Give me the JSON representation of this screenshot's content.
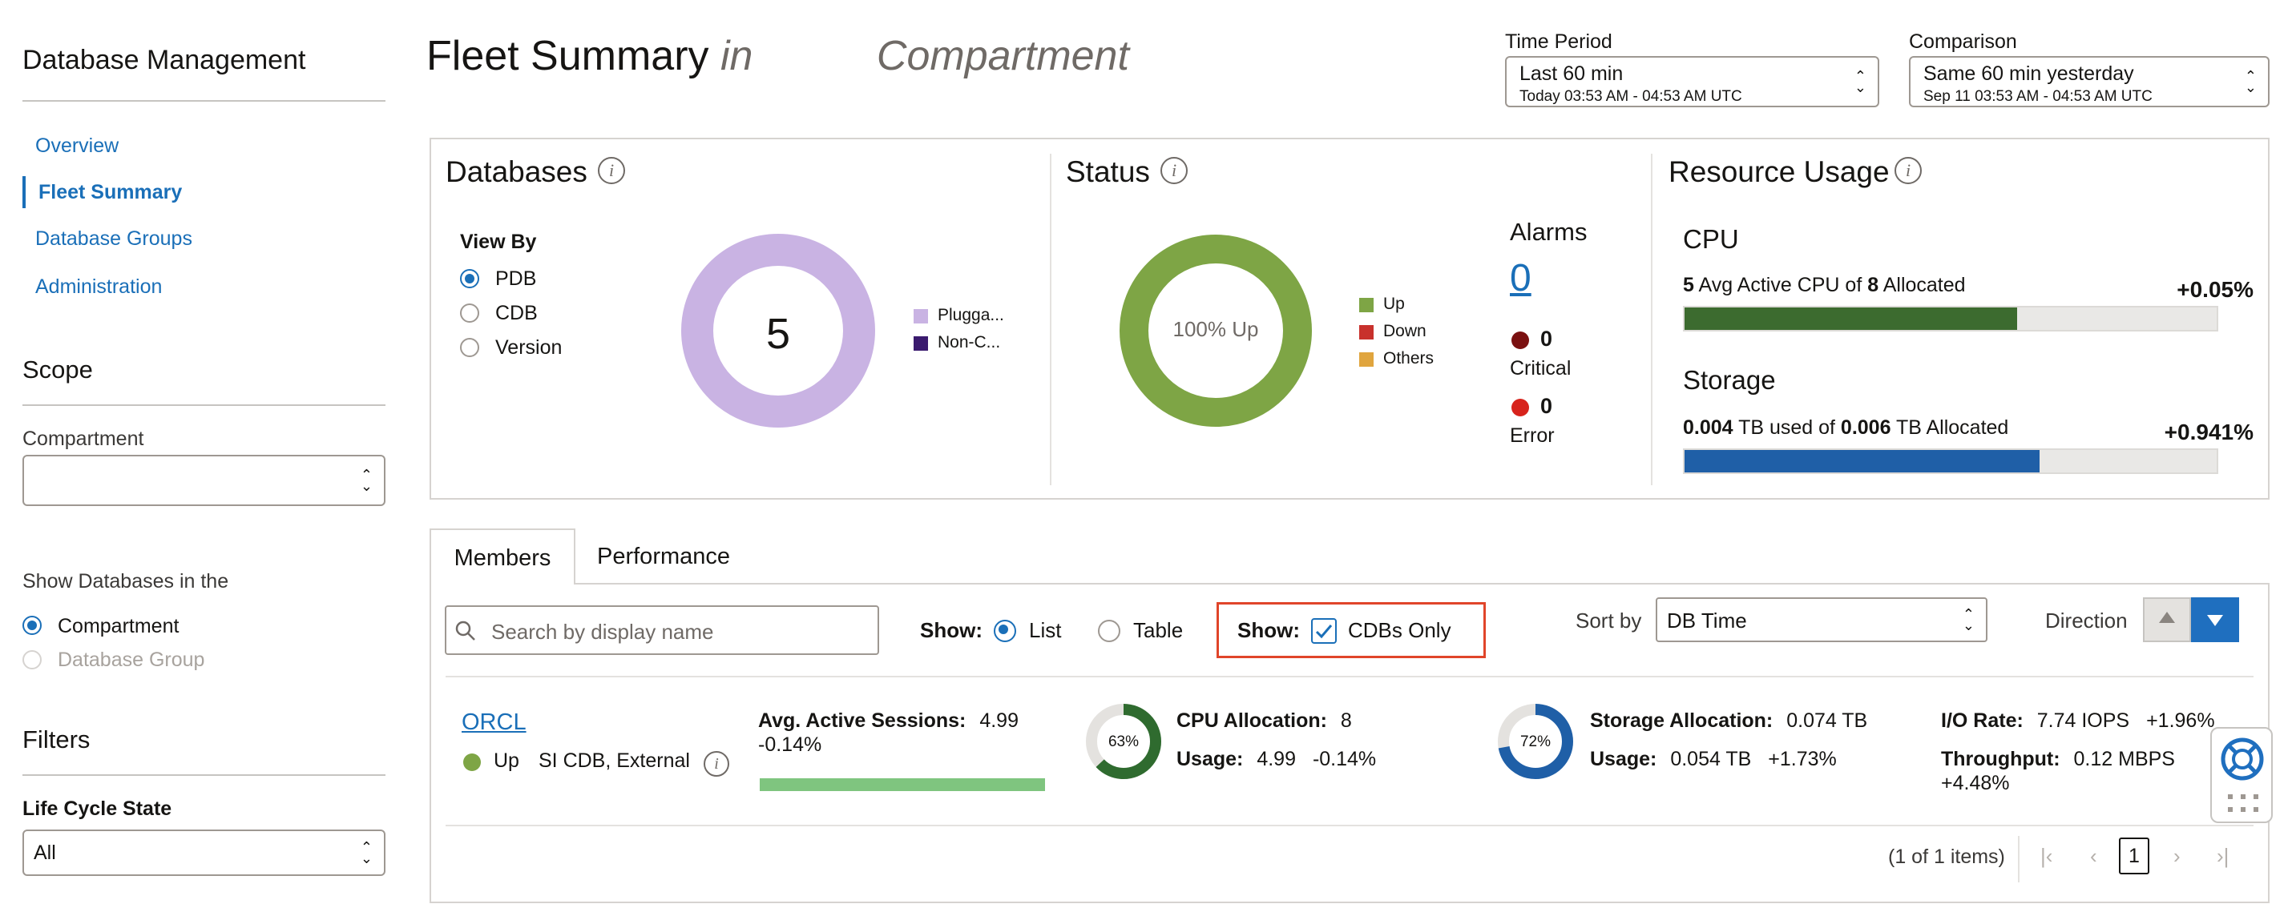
{
  "sidebar": {
    "title": "Database Management",
    "nav": [
      {
        "label": "Overview"
      },
      {
        "label": "Fleet Summary"
      },
      {
        "label": "Database Groups"
      },
      {
        "label": "Administration"
      }
    ],
    "scope_title": "Scope",
    "compartment_label": "Compartment",
    "compartment_value": "",
    "show_databases_label": "Show Databases in the",
    "show_options": [
      {
        "label": "Compartment",
        "selected": true
      },
      {
        "label": "Database Group",
        "selected": false
      }
    ],
    "filters_title": "Filters",
    "lifecycle_label": "Life Cycle State",
    "lifecycle_value": "All"
  },
  "header": {
    "title_main": "Fleet Summary",
    "title_in": "in",
    "title_compartment": "Compartment",
    "time_period_label": "Time Period",
    "time_period_value": "Last 60 min",
    "time_period_sub": "Today 03:53 AM - 04:53 AM UTC",
    "comparison_label": "Comparison",
    "comparison_value": "Same 60 min yesterday",
    "comparison_sub": "Sep 11 03:53 AM - 04:53 AM UTC"
  },
  "databases": {
    "title": "Databases",
    "view_by_label": "View By",
    "view_by_options": [
      {
        "label": "PDB",
        "selected": true
      },
      {
        "label": "CDB",
        "selected": false
      },
      {
        "label": "Version",
        "selected": false
      }
    ],
    "count": "5",
    "legend": [
      {
        "label": "Plugga...",
        "color": "#c9b3e3"
      },
      {
        "label": "Non-C...",
        "color": "#3a1a6e"
      }
    ]
  },
  "status": {
    "title": "Status",
    "donut_label": "100% Up",
    "donut_color": "#7ea545",
    "legend": [
      {
        "label": "Up",
        "color": "#7ea545"
      },
      {
        "label": "Down",
        "color": "#c8312c"
      },
      {
        "label": "Others",
        "color": "#e0a53e"
      }
    ],
    "alarms_title": "Alarms",
    "alarms_count": "0",
    "critical_count": "0",
    "critical_label": "Critical",
    "critical_color": "#7a1010",
    "error_count": "0",
    "error_label": "Error",
    "error_color": "#d7231c"
  },
  "resource": {
    "title": "Resource Usage",
    "cpu_title": "CPU",
    "cpu_avg": "5",
    "cpu_text1": "Avg Active CPU of",
    "cpu_alloc": "8",
    "cpu_text2": "Allocated",
    "cpu_change": "+0.05%",
    "cpu_fraction": 0.625,
    "cpu_color": "#3c6b2f",
    "storage_title": "Storage",
    "storage_used": "0.004",
    "storage_text1": "TB used of",
    "storage_alloc": "0.006",
    "storage_text2": "TB Allocated",
    "storage_change": "+0.941%",
    "storage_fraction": 0.667,
    "storage_color": "#1f5fa7"
  },
  "tabs": [
    {
      "label": "Members",
      "active": true
    },
    {
      "label": "Performance",
      "active": false
    }
  ],
  "toolbar": {
    "search_placeholder": "Search by display name",
    "show_label": "Show:",
    "list_label": "List",
    "table_label": "Table",
    "show2_label": "Show:",
    "cdbs_only_label": "CDBs Only",
    "sort_by_label": "Sort by",
    "sort_value": "DB Time",
    "direction_label": "Direction"
  },
  "member": {
    "name": "ORCL",
    "status": "Up",
    "type": "SI CDB, External",
    "aas_label": "Avg. Active Sessions:",
    "aas_value": "4.99",
    "aas_change": "-0.14%",
    "aas_bar_color": "#7fc57f",
    "cpu_gauge": "63%",
    "cpu_gauge_fraction": 0.63,
    "cpu_alloc_label": "CPU Allocation:",
    "cpu_alloc_value": "8",
    "cpu_usage_label": "Usage:",
    "cpu_usage_value": "4.99",
    "cpu_usage_change": "-0.14%",
    "storage_gauge": "72%",
    "storage_gauge_fraction": 0.72,
    "storage_alloc_label": "Storage Allocation:",
    "storage_alloc_value": "0.074 TB",
    "storage_usage_label": "Usage:",
    "storage_usage_value": "0.054 TB",
    "storage_usage_change": "+1.73%",
    "io_label": "I/O Rate:",
    "io_value": "7.74 IOPS",
    "io_change": "+1.96%",
    "throughput_label": "Throughput:",
    "throughput_value": "0.12 MBPS",
    "throughput_change": "+4.48%"
  },
  "pagination": {
    "summary": "(1 of 1 items)",
    "current_page": "1"
  },
  "colors": {
    "accent": "#1a6fb8",
    "highlight_box": "#e0452a"
  }
}
